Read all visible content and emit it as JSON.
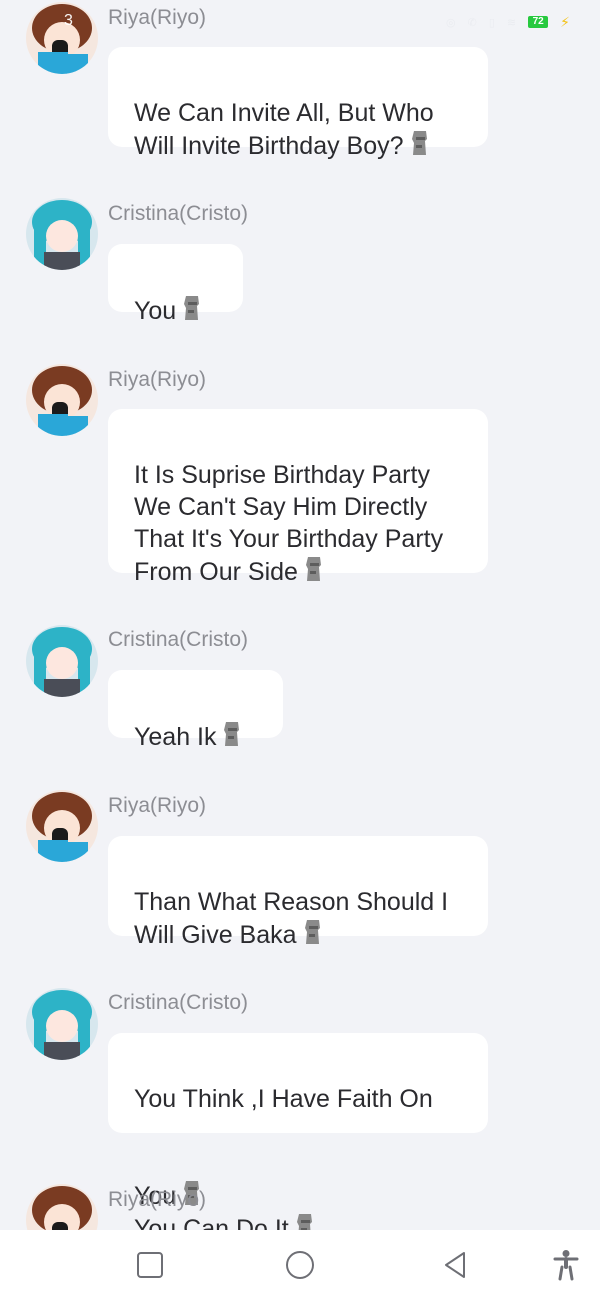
{
  "status_bar": {
    "time_partial": "3",
    "battery": "72"
  },
  "messages": [
    {
      "sender": "Riya(Riyo)",
      "text": "We Can Invite All, But Who\nWill Invite Birthday Boy?",
      "avatar": "riya-avatar"
    },
    {
      "sender": "Cristina(Cristo)",
      "text": "You",
      "avatar": "cristina-avatar"
    },
    {
      "sender": "Riya(Riyo)",
      "text": "It Is Suprise Birthday Party\nWe Can't Say Him Directly\nThat It's Your Birthday Party\nFrom Our Side",
      "avatar": "riya-avatar"
    },
    {
      "sender": "Cristina(Cristo)",
      "text": "Yeah Ik",
      "avatar": "cristina-avatar"
    },
    {
      "sender": "Riya(Riyo)",
      "text": "Than What Reason Should I\nWill Give Baka",
      "avatar": "riya-avatar"
    },
    {
      "sender": "Cristina(Cristo)",
      "text_line1": "You Think ,I Have Faith On",
      "text_line2a": "You",
      "text_line2b": "You Can Do It",
      "avatar": "cristina-avatar"
    },
    {
      "sender": "Riya(Riyo)",
      "avatar": "riya-avatar"
    }
  ],
  "navbar": {
    "items": [
      "square-icon",
      "circle-icon",
      "back-triangle-icon",
      "accessibility-icon"
    ]
  }
}
